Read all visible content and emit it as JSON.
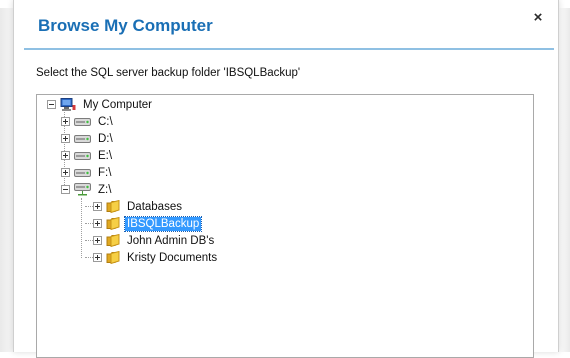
{
  "dialog": {
    "title": "Browse My Computer",
    "close_glyph": "×",
    "prompt": "Select the SQL server backup folder 'IBSQLBackup'"
  },
  "tree": {
    "root": {
      "label": "My Computer",
      "icon": "computer-icon",
      "expanded": true
    },
    "drives": [
      {
        "label": "C:\\",
        "icon": "drive-icon",
        "expanded": false
      },
      {
        "label": "D:\\",
        "icon": "drive-icon",
        "expanded": false
      },
      {
        "label": "E:\\",
        "icon": "drive-icon",
        "expanded": false
      },
      {
        "label": "F:\\",
        "icon": "drive-icon",
        "expanded": false
      },
      {
        "label": "Z:\\",
        "icon": "network-drive-icon",
        "expanded": true
      }
    ],
    "folders": [
      {
        "label": "Databases",
        "icon": "folder-icon",
        "selected": false
      },
      {
        "label": "IBSQLBackup",
        "icon": "folder-icon",
        "selected": true
      },
      {
        "label": "John Admin DB's",
        "icon": "folder-icon",
        "selected": false
      },
      {
        "label": "Kristy Documents",
        "icon": "folder-icon",
        "selected": false
      }
    ]
  },
  "colors": {
    "title": "#1a6fb5",
    "separator": "#8fc0e3",
    "selection": "#3399ff",
    "folder": "#f2c12e"
  }
}
